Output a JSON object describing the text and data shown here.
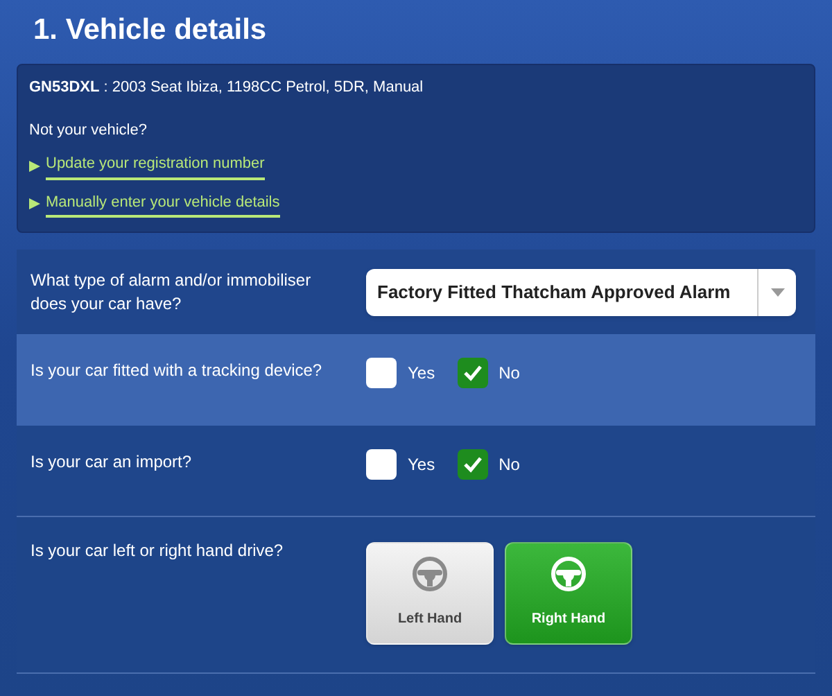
{
  "title": "1. Vehicle details",
  "vehicle": {
    "registration": "GN53DXL",
    "description": " : 2003 Seat Ibiza, 1198CC Petrol, 5DR, Manual",
    "prompt": "Not your vehicle?",
    "links": [
      "Update your registration number",
      "Manually enter your vehicle details"
    ]
  },
  "questions": [
    {
      "kind": "select",
      "label": "What type of alarm and/or immobiliser does your car have?",
      "value": "Factory Fitted Thatcham Approved Alarm",
      "highlighted": false
    },
    {
      "kind": "checkboxes",
      "label": "Is your car fitted with a tracking device?",
      "highlighted": true,
      "options": [
        {
          "label": "Yes",
          "checked": false
        },
        {
          "label": "No",
          "checked": true
        }
      ]
    },
    {
      "kind": "checkboxes",
      "label": "Is your car an import?",
      "highlighted": false,
      "options": [
        {
          "label": "Yes",
          "checked": false
        },
        {
          "label": "No",
          "checked": true
        }
      ]
    },
    {
      "kind": "tiles",
      "label": "Is your car left or right hand drive?",
      "highlighted": false,
      "options": [
        {
          "label": "Left Hand",
          "selected": false
        },
        {
          "label": "Right Hand",
          "selected": true
        }
      ]
    }
  ]
}
